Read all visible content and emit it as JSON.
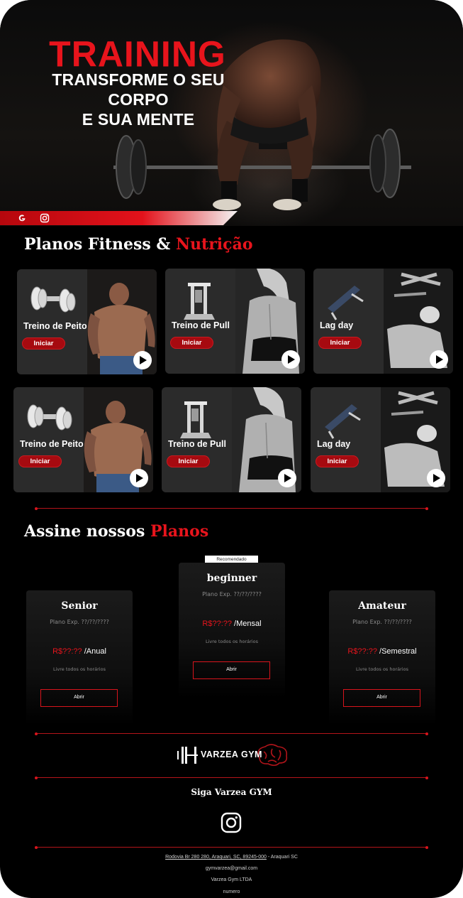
{
  "hero": {
    "title": "TRAINING",
    "subtitle_line1": "TRANSFORME O SEU  CORPO",
    "subtitle_line2": "E SUA MENTE",
    "social_icons": [
      "google-icon",
      "instagram-icon"
    ],
    "accent_color": "#e8141c"
  },
  "fitness_section": {
    "title_main": "Planos Fitness & ",
    "title_accent": "Nutrição"
  },
  "workout_cards": [
    {
      "label": "Treino de Peito",
      "button": "Iniciar",
      "equipment_icon": "dumbbell-icon",
      "photo": "shirtless-athlete"
    },
    {
      "label": "Treino de Pull",
      "button": "Iniciar",
      "equipment_icon": "pull-machine-icon",
      "photo": "woman-back"
    },
    {
      "label": "Lag day",
      "button": "Iniciar",
      "equipment_icon": "bench-icon",
      "photo": "leg-press-athlete"
    },
    {
      "label": "Treino de Peito",
      "button": "Iniciar",
      "equipment_icon": "dumbbell-icon",
      "photo": "shirtless-athlete"
    },
    {
      "label": "Treino de Pull",
      "button": "Iniciar",
      "equipment_icon": "pull-machine-icon",
      "photo": "woman-back"
    },
    {
      "label": "Lag day",
      "button": "Iniciar",
      "equipment_icon": "bench-icon",
      "photo": "leg-press-athlete"
    }
  ],
  "plans_section": {
    "title_main": "Assine nossos ",
    "title_accent": "Planos",
    "recommended_badge": "Recomendado"
  },
  "plans": [
    {
      "name": "Senior",
      "exp": "Plano Exp.  ??/??/????",
      "amount": "R$??:??",
      "period": " /Anual",
      "hours": "Livre todos os horários",
      "button": "Abrir"
    },
    {
      "name": "beginner",
      "exp": "Plano Exp.  ??/??/????",
      "amount": "R$??:??",
      "period": " /Mensal",
      "hours": "Livre todos os horários",
      "button": "Abrir"
    },
    {
      "name": "Amateur",
      "exp": "Plano Exp.  ??/??/????",
      "amount": "R$??:??",
      "period": " /Semestral",
      "hours": "Livre todos os horários",
      "button": "Abrir"
    }
  ],
  "footer": {
    "brand": "VARZEA GYM",
    "follow": "Siga Varzea GYM",
    "address_link": "Rodovia Br 280 280, Araquari, SC, 89245-000",
    "address_suffix": " - Araquari SC",
    "email": "gymvarzea@gmail.com",
    "company": "Varzea Gym LTDA",
    "number": "numero"
  }
}
